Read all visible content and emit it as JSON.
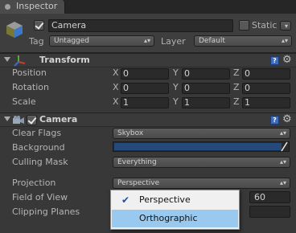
{
  "window": {
    "tab_label": "Inspector",
    "icon": "inspector-icon"
  },
  "object": {
    "name": "Camera",
    "active": true,
    "static_label": "Static",
    "static_checked": false,
    "tag_label": "Tag",
    "tag_value": "Untagged",
    "layer_label": "Layer",
    "layer_value": "Default"
  },
  "transform": {
    "title": "Transform",
    "rows": [
      {
        "label": "Position",
        "x": "0",
        "y": "0",
        "z": "0"
      },
      {
        "label": "Rotation",
        "x": "0",
        "y": "0",
        "z": "0"
      },
      {
        "label": "Scale",
        "x": "1",
        "y": "1",
        "z": "1"
      }
    ],
    "axes": [
      "X",
      "Y",
      "Z"
    ]
  },
  "camera": {
    "title": "Camera",
    "enabled": true,
    "clear_flags_label": "Clear Flags",
    "clear_flags_value": "Skybox",
    "background_label": "Background",
    "background_color": "#244a7c",
    "culling_mask_label": "Culling Mask",
    "culling_mask_value": "Everything",
    "projection_label": "Projection",
    "projection_value": "Perspective",
    "fov_label": "Field of View",
    "fov_value": "60",
    "clipping_label": "Clipping Planes"
  },
  "projection_menu": {
    "options": [
      "Perspective",
      "Orthographic"
    ],
    "checked": "Perspective",
    "highlighted": "Orthographic"
  },
  "colors": {
    "panel_bg": "#383838",
    "menu_highlight": "#99c9ef",
    "help_icon": "#3c6cbe"
  }
}
